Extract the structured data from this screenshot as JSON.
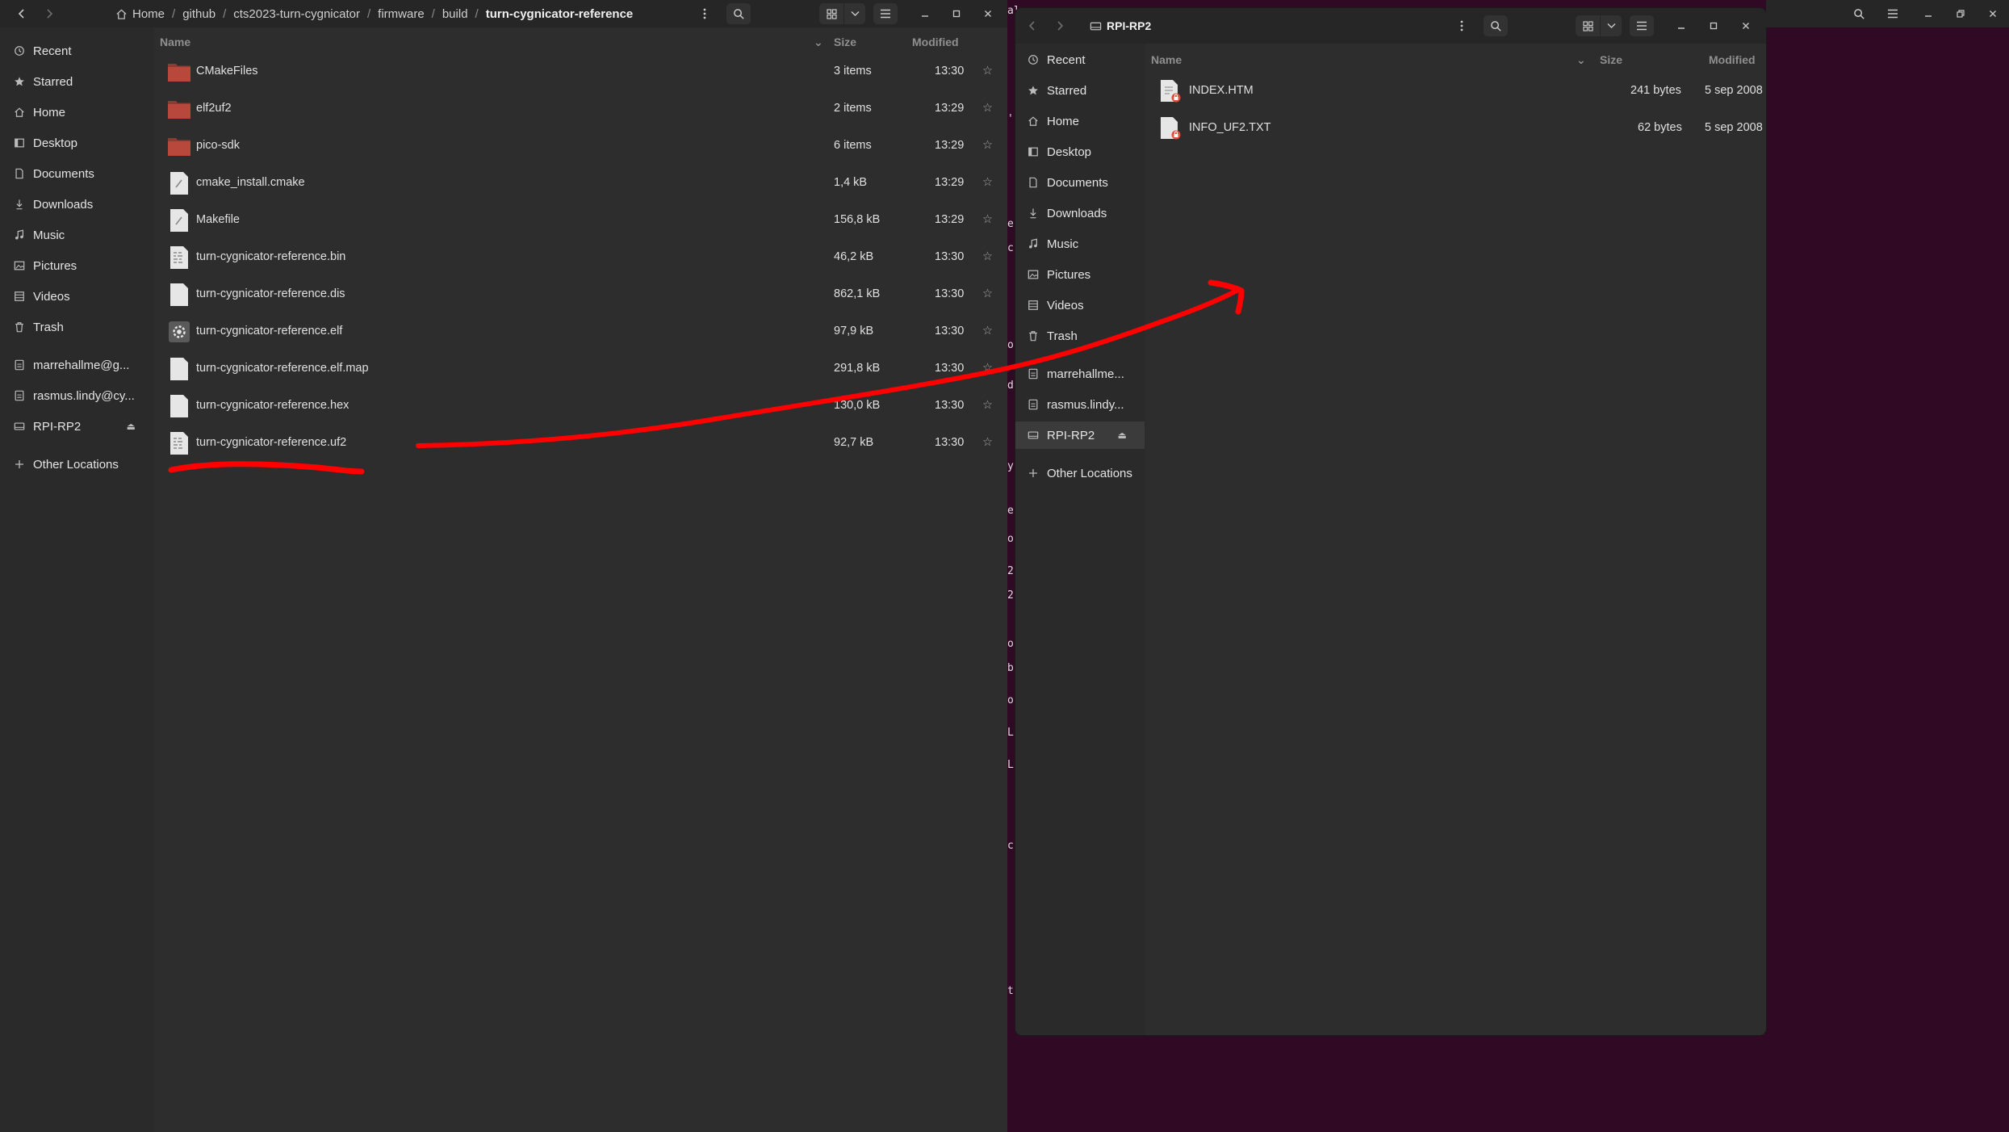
{
  "left_window": {
    "breadcrumb": [
      "Home",
      "github",
      "cts2023-turn-cygnicator",
      "firmware",
      "build",
      "turn-cygnicator-reference"
    ],
    "columns": {
      "name": "Name",
      "size": "Size",
      "modified": "Modified"
    },
    "sidebar": [
      {
        "label": "Recent",
        "icon": "clock-icon"
      },
      {
        "label": "Starred",
        "icon": "star-icon"
      },
      {
        "label": "Home",
        "icon": "home-icon"
      },
      {
        "label": "Desktop",
        "icon": "desktop-icon"
      },
      {
        "label": "Documents",
        "icon": "document-icon"
      },
      {
        "label": "Downloads",
        "icon": "download-icon"
      },
      {
        "label": "Music",
        "icon": "music-icon"
      },
      {
        "label": "Pictures",
        "icon": "picture-icon"
      },
      {
        "label": "Videos",
        "icon": "video-icon"
      },
      {
        "label": "Trash",
        "icon": "trash-icon"
      },
      {
        "label": "marrehallme@g...",
        "icon": "drive-icon"
      },
      {
        "label": "rasmus.lindy@cy...",
        "icon": "drive-icon"
      },
      {
        "label": "RPI-RP2",
        "icon": "disk-icon"
      },
      {
        "label": "Other Locations",
        "icon": "plus-icon"
      }
    ],
    "files": [
      {
        "name": "CMakeFiles",
        "size": "3 items",
        "modified": "13:30",
        "type": "folder"
      },
      {
        "name": "elf2uf2",
        "size": "2 items",
        "modified": "13:29",
        "type": "folder"
      },
      {
        "name": "pico-sdk",
        "size": "6 items",
        "modified": "13:29",
        "type": "folder"
      },
      {
        "name": "cmake_install.cmake",
        "size": "1,4 kB",
        "modified": "13:29",
        "type": "script"
      },
      {
        "name": "Makefile",
        "size": "156,8 kB",
        "modified": "13:29",
        "type": "script"
      },
      {
        "name": "turn-cygnicator-reference.bin",
        "size": "46,2 kB",
        "modified": "13:30",
        "type": "binary"
      },
      {
        "name": "turn-cygnicator-reference.dis",
        "size": "862,1 kB",
        "modified": "13:30",
        "type": "text"
      },
      {
        "name": "turn-cygnicator-reference.elf",
        "size": "97,9 kB",
        "modified": "13:30",
        "type": "executable"
      },
      {
        "name": "turn-cygnicator-reference.elf.map",
        "size": "291,8 kB",
        "modified": "13:30",
        "type": "text"
      },
      {
        "name": "turn-cygnicator-reference.hex",
        "size": "130,0 kB",
        "modified": "13:30",
        "type": "text"
      },
      {
        "name": "turn-cygnicator-reference.uf2",
        "size": "92,7 kB",
        "modified": "13:30",
        "type": "binary"
      }
    ]
  },
  "right_window": {
    "title": "RPI-RP2",
    "columns": {
      "name": "Name",
      "size": "Size",
      "modified": "Modified"
    },
    "sidebar": [
      {
        "label": "Recent",
        "icon": "clock-icon"
      },
      {
        "label": "Starred",
        "icon": "star-icon"
      },
      {
        "label": "Home",
        "icon": "home-icon"
      },
      {
        "label": "Desktop",
        "icon": "desktop-icon"
      },
      {
        "label": "Documents",
        "icon": "document-icon"
      },
      {
        "label": "Downloads",
        "icon": "download-icon"
      },
      {
        "label": "Music",
        "icon": "music-icon"
      },
      {
        "label": "Pictures",
        "icon": "picture-icon"
      },
      {
        "label": "Videos",
        "icon": "video-icon"
      },
      {
        "label": "Trash",
        "icon": "trash-icon"
      },
      {
        "label": "marrehallme...",
        "icon": "drive-icon"
      },
      {
        "label": "rasmus.lindy...",
        "icon": "drive-icon"
      },
      {
        "label": "RPI-RP2",
        "icon": "disk-icon"
      },
      {
        "label": "Other Locations",
        "icon": "plus-icon"
      }
    ],
    "files": [
      {
        "name": "INDEX.HTM",
        "size": "241 bytes",
        "modified": "5 sep 2008",
        "type": "html-locked"
      },
      {
        "name": "INFO_UF2.TXT",
        "size": "62 bytes",
        "modified": "5 sep 2008",
        "type": "text-locked"
      }
    ]
  },
  "colors": {
    "desktop": "#300a24",
    "window": "#2c2c2c",
    "sidebar": "#2a2a2a",
    "headerbar": "#262626",
    "folder": "#c0392b",
    "annotation": "#ff0000"
  }
}
